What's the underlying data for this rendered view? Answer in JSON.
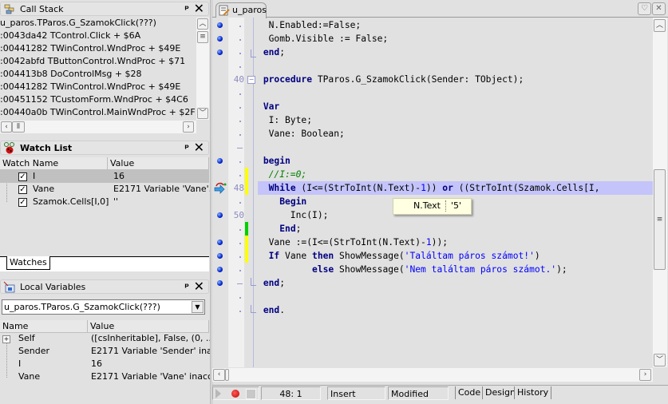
{
  "call_stack": {
    "title": "Call Stack",
    "icon": "call-stack-icon",
    "entries": [
      "u_paros.TParos.G_SzamokClick(???)",
      ":0043da42 TControl.Click + $6A",
      ":00441282 TWinControl.WndProc + $49E",
      ":0042abfd TButtonControl.WndProc + $71",
      ":004413b8 DoControlMsg + $28",
      ":00441282 TWinControl.WndProc + $49E",
      ":00451152 TCustomForm.WndProc + $4C6",
      ":00440a0b TWinControl.MainWndProc + $2F"
    ]
  },
  "watch_list": {
    "title": "Watch List",
    "icon": "ladybug-icon",
    "columns": [
      "Watch Name",
      "Value"
    ],
    "rows": [
      {
        "name": "I",
        "value": "16",
        "checked": true,
        "selected": true
      },
      {
        "name": "Vane",
        "value": "E2171 Variable 'Vane'...",
        "checked": true
      },
      {
        "name": "Szamok.Cells[I,0]",
        "value": "''",
        "checked": true
      }
    ],
    "tab": "Watches"
  },
  "local_variables": {
    "title": "Local Variables",
    "icon": "local-variables-icon",
    "scope_select": "u_paros.TParos.G_SzamokClick(???)",
    "columns": [
      "Name",
      "Value"
    ],
    "rows": [
      {
        "name": "Self",
        "value": "([csInheritable], False, (0, ...",
        "expandable": true
      },
      {
        "name": "Sender",
        "value": "E2171 Variable 'Sender' ina..."
      },
      {
        "name": "I",
        "value": "16"
      },
      {
        "name": "Vane",
        "value": "E2171 Variable 'Vane' inacc..."
      }
    ]
  },
  "editor": {
    "tab_label": "u_paros",
    "lines": [
      {
        "text": "  N.Enabled:=False;"
      },
      {
        "text": "  Gomb.Visible := False;"
      },
      {
        "text": " end;"
      },
      {
        "text": ""
      },
      {
        "number": "40",
        "text": " procedure TParos.G_SzamokClick(Sender: TObject);"
      },
      {
        "text": ""
      },
      {
        "text": " Var"
      },
      {
        "text": "  I: Byte;"
      },
      {
        "text": "  Vane: Boolean;"
      },
      {
        "text": ""
      },
      {
        "text": " begin"
      },
      {
        "text": "  //I:=0;"
      },
      {
        "number": "48",
        "text": "  While (I<=(StrToInt(N.Text)-1)) or ((StrToInt(Szamok.Cells[I,"
      },
      {
        "text": "    Begin"
      },
      {
        "number": "50",
        "text": "      Inc(I);"
      },
      {
        "text": "    End;"
      },
      {
        "text": "  Vane :=(I<=(StrToInt(N.Text)-1));"
      },
      {
        "text": "  If Vane then ShowMessage('Találtam páros számot!')"
      },
      {
        "text": "          else ShowMessage('Nem találtam páros számot.');"
      },
      {
        "text": " end;"
      },
      {
        "text": ""
      },
      {
        "text": " end."
      }
    ],
    "tooltip": {
      "expression": "N.Text",
      "value": "'5'"
    },
    "colors": {
      "execution_line": "#c4c4fa",
      "modified_bar": "#ffff00",
      "saved_bar": "#00d000",
      "keyword": "#000080",
      "string": "#0000ff",
      "comment": "#008000"
    }
  },
  "status_bar": {
    "position": "48:  1",
    "mode": "Insert",
    "state": "Modified",
    "tabs": [
      "Code",
      "Design",
      "History"
    ],
    "active_tab": "Code"
  }
}
